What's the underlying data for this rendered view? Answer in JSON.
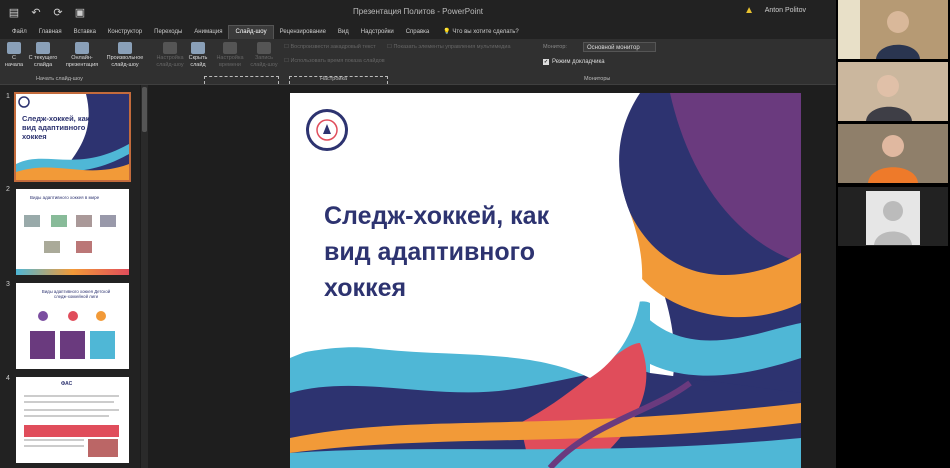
{
  "window": {
    "title": "Презентация Политов - PowerPoint",
    "user": "Anton Politov",
    "quick_access": [
      "save-icon",
      "undo-icon",
      "redo-icon",
      "start-presentation-icon"
    ]
  },
  "ribbon_tabs": [
    {
      "label": "Файл"
    },
    {
      "label": "Главная"
    },
    {
      "label": "Вставка"
    },
    {
      "label": "Конструктор"
    },
    {
      "label": "Переходы"
    },
    {
      "label": "Анимация"
    },
    {
      "label": "Слайд-шоу",
      "active": true
    },
    {
      "label": "Рецензирование"
    },
    {
      "label": "Вид"
    },
    {
      "label": "Надстройки"
    },
    {
      "label": "Справка"
    }
  ],
  "tell_me": "Что вы хотите сделать?",
  "ribbon": {
    "from_beginning": "С начала",
    "from_current": "С текущего слайда",
    "online": "Онлайн-презентация",
    "custom": "Произвольное слайд-шоу",
    "group_start": "Начать слайд-шоу",
    "setup_show": "Настройка слайд-шоу",
    "hide_slide": "Скрыть слайд",
    "rehearse": "Настройка времени",
    "record": "Запись слайд-шоу",
    "play_narrations": "Воспроизвести закадровый текст",
    "use_timings": "Использовать время показа слайдов",
    "show_media": "Показать элементы управления мультимедиа",
    "group_setup": "Настройка",
    "monitor_label": "Монитор:",
    "monitor_value": "Основной монитор",
    "presenter_view": "Режим докладчика",
    "group_monitors": "Мониторы"
  },
  "thumbnails": [
    {
      "num": "1",
      "title": "Следж-хоккей, как вид адаптивного хоккея",
      "selected": true
    },
    {
      "num": "2",
      "title": "Виды адаптивного хоккея в мире"
    },
    {
      "num": "3",
      "title": "Виды адаптивного хоккея Детской следж-хоккейной лиги"
    },
    {
      "num": "4",
      "title": "ФАС"
    }
  ],
  "slide": {
    "title_line1": "Следж-хоккей, как",
    "title_line2": "вид адаптивного",
    "title_line3": "хоккея"
  },
  "colors": {
    "accent": "#c36b3c",
    "slide_title": "#2d3370",
    "wave_navy": "#2d3370",
    "wave_purple": "#6a3a7e",
    "wave_cyan": "#4fb7d6",
    "wave_orange": "#f29a38",
    "wave_red": "#e04d5b"
  }
}
